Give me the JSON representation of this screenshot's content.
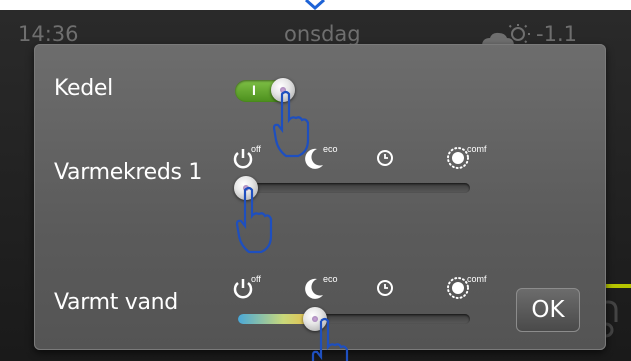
{
  "status_bar": {
    "time": "14:36",
    "day": "onsdag",
    "weather_icon": "partly-cloudy-icon",
    "temperature": "-1.1"
  },
  "dialog": {
    "boiler": {
      "label": "Kedel",
      "toggle_text": "I",
      "state_on": true
    },
    "heating_circuit_1": {
      "label": "Varmekreds 1",
      "modes": [
        {
          "icon": "power-off-icon",
          "label": "off"
        },
        {
          "icon": "moon-icon",
          "label": "eco"
        },
        {
          "icon": "clock-icon",
          "label": ""
        },
        {
          "icon": "sun-icon",
          "label": "comf"
        }
      ],
      "slider_level": 0
    },
    "hot_water": {
      "label": "Varmt vand",
      "modes": [
        {
          "icon": "power-off-icon",
          "label": "off"
        },
        {
          "icon": "moon-icon",
          "label": "eco"
        },
        {
          "icon": "clock-icon",
          "label": ""
        },
        {
          "icon": "sun-icon",
          "label": "comf"
        }
      ],
      "slider_level": 0.33
    },
    "ok_label": "OK"
  },
  "colors": {
    "toggle_on": "#5fa52c",
    "dialog_bg": "#616161",
    "fill_start": "#4aa8d8",
    "fill_end": "#f2b53a",
    "pointer_outline": "#1e4fbf"
  }
}
